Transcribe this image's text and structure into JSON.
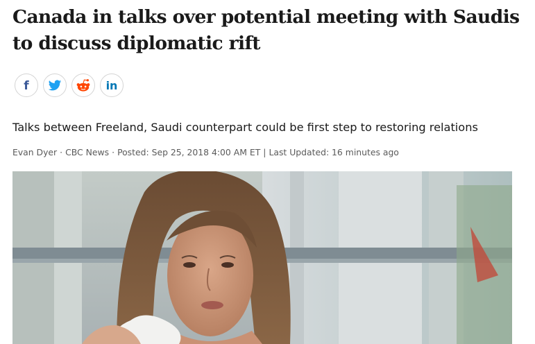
{
  "article": {
    "headline": "Canada in talks over potential meeting with Saudis to discuss diplomatic rift",
    "deck": "Talks between Freeland, Saudi counterpart could be first step to restoring relations",
    "byline": {
      "author": "Evan Dyer",
      "source": "CBC News",
      "posted": "Posted: Sep 25, 2018 4:00 AM ET",
      "separator": "|",
      "updated": "Last Updated: 16 minutes ago"
    }
  },
  "share": [
    {
      "icon": "facebook-icon",
      "glyph": "f",
      "color": "#3b5998"
    },
    {
      "icon": "twitter-icon",
      "color": "#1da1f2"
    },
    {
      "icon": "reddit-icon",
      "color": "#ff4500"
    },
    {
      "icon": "linkedin-icon",
      "glyph": "in",
      "color": "#0077b5"
    }
  ],
  "colors": {
    "headline": "#1a1a1a",
    "byline": "#5a5a5a",
    "share_border": "#d4d4d4"
  }
}
